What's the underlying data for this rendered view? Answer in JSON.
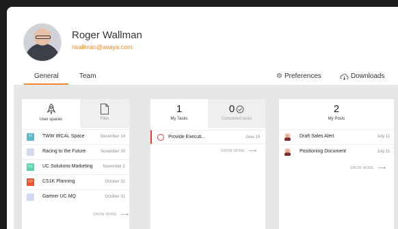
{
  "profile": {
    "name": "Roger Wallman",
    "email": "rwallman@avaya.com"
  },
  "tabs": {
    "general": "General",
    "team": "Team",
    "preferences": "Preferences",
    "downloads": "Downloads"
  },
  "spaces_card": {
    "tab_spaces": "User spaces",
    "tab_files": "Files",
    "items": [
      {
        "badge": "TI",
        "badge_color": "#58b9c9",
        "name": "TWW IRCAL Space",
        "date": "December 14"
      },
      {
        "badge": "",
        "badge_color": "#d3d8f3",
        "name": "Racing to the Future",
        "date": "November 30"
      },
      {
        "badge": "UC",
        "badge_color": "#5bd3a8",
        "name": "UC Solutions Marketing",
        "date": "November 2"
      },
      {
        "badge": "CP",
        "badge_color": "#e8532c",
        "name": "CS1K Planning",
        "date": "October 31"
      },
      {
        "badge": "",
        "badge_color": "#d3d8f3",
        "name": "Gartner UC MQ",
        "date": "October 31"
      }
    ],
    "show_more": "SHOW MORE"
  },
  "tasks_card": {
    "my_tasks_count": "1",
    "my_tasks_label": "My Tasks",
    "completed_count": "0",
    "completed_label": "Completed tasks",
    "task": {
      "name": "Provide Executi...",
      "date": "June 19"
    },
    "show_more": "SHOW MORE"
  },
  "posts_card": {
    "count": "2",
    "label": "My Posts",
    "items": [
      {
        "name": "Draft Sales Alert",
        "date": "July 11"
      },
      {
        "name": "Positioning Document",
        "date": "July 11"
      }
    ],
    "show_more": "SHOW MORE"
  },
  "colors": {
    "accent": "#f0892b",
    "task_red": "#e53935"
  },
  "icons": [
    "rocket-icon",
    "file-icon",
    "check-circle-icon",
    "gear-icon",
    "cloud-download-icon",
    "arrow-right-icon"
  ]
}
